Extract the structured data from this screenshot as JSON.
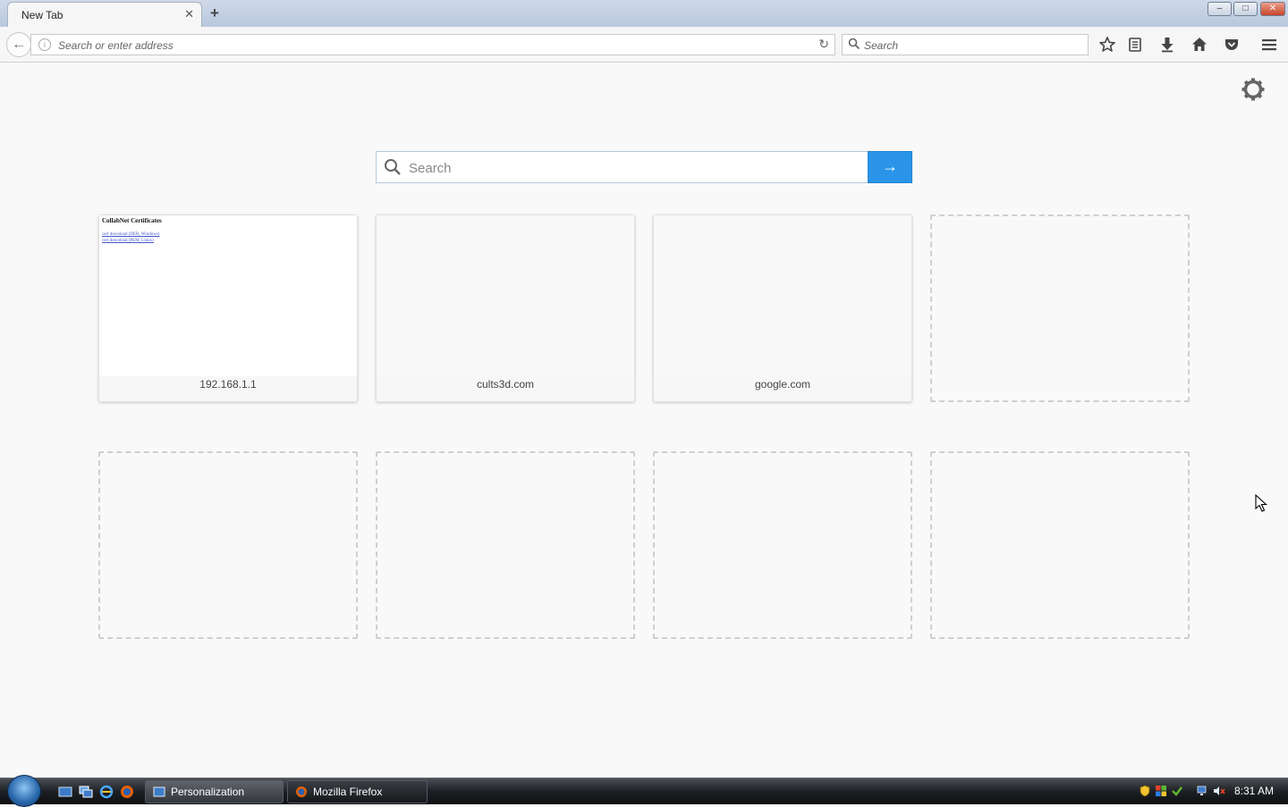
{
  "tabs": [
    {
      "label": "New Tab"
    }
  ],
  "window_controls": {
    "minimize": "–",
    "maximize": "□",
    "close": "✕"
  },
  "navbar": {
    "url_placeholder": "Search or enter address",
    "search_placeholder": "Search"
  },
  "content": {
    "search_placeholder": "Search",
    "search_go": "→",
    "tiles_row1": [
      {
        "title": "192.168.1.1",
        "thumb_heading": "CollabNet Certificates",
        "thumb_links": [
          "cert download (DER, Windows)",
          "cert download (PEM, Linux)"
        ]
      },
      {
        "title": "cults3d.com"
      },
      {
        "title": "google.com"
      }
    ]
  },
  "taskbar": {
    "items": [
      {
        "label": "Personalization"
      },
      {
        "label": "Mozilla Firefox"
      }
    ],
    "clock": "8:31 AM"
  },
  "colors": {
    "accent": "#2a95e8",
    "titlebar": "#c4d1e3",
    "taskbar": "#1d2024"
  },
  "icons": [
    "back-icon",
    "info-icon",
    "reload-icon",
    "search-icon",
    "bookmark-star-icon",
    "reading-list-icon",
    "download-icon",
    "home-icon",
    "pocket-icon",
    "hamburger-menu-icon",
    "gear-icon",
    "arrow-right-icon",
    "windows-start-icon",
    "firefox-icon",
    "ie-icon",
    "desktop-icon",
    "volume-muted-icon",
    "network-icon"
  ]
}
